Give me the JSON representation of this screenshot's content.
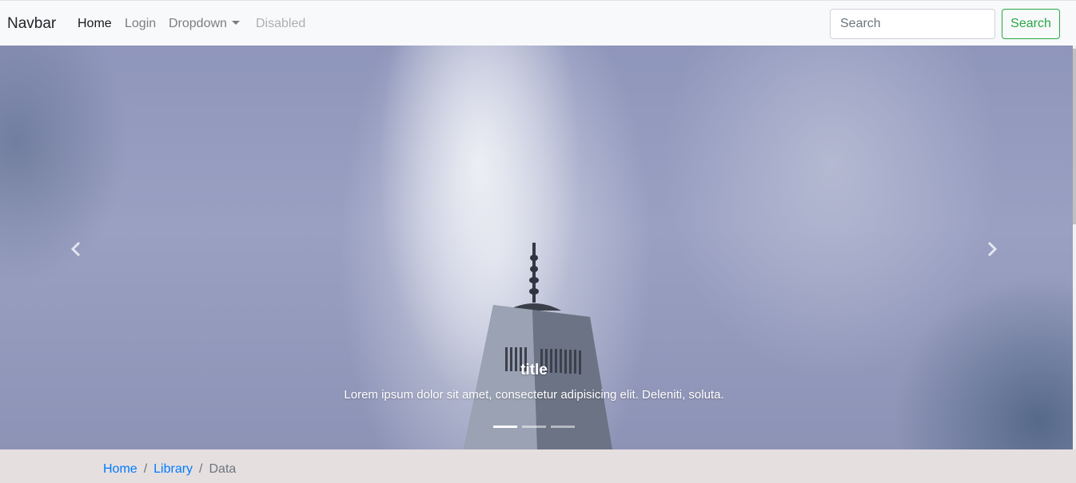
{
  "navbar": {
    "brand": "Navbar",
    "links": [
      {
        "label": "Home",
        "state": "active"
      },
      {
        "label": "Login",
        "state": "normal"
      },
      {
        "label": "Dropdown",
        "state": "normal"
      },
      {
        "label": "Disabled",
        "state": "disabled"
      }
    ],
    "search": {
      "placeholder": "Search",
      "button_label": "Search"
    }
  },
  "carousel": {
    "caption_title": "title",
    "caption_text": "Lorem ipsum dolor sit amet, consectetur adipisicing elit. Deleniti, soluta.",
    "indicators": 3,
    "active_indicator": 1,
    "prev_icon": "chevron-left-icon",
    "next_icon": "chevron-right-icon"
  },
  "breadcrumb": {
    "items": [
      {
        "label": "Home",
        "link": true
      },
      {
        "label": "Library",
        "link": true
      },
      {
        "label": "Data",
        "link": false
      }
    ],
    "separator": "/"
  },
  "colors": {
    "navbar_bg": "#f8f9fa",
    "success": "#28a745",
    "link": "#007bff",
    "breadcrumb_bg": "#e6dfe0"
  }
}
